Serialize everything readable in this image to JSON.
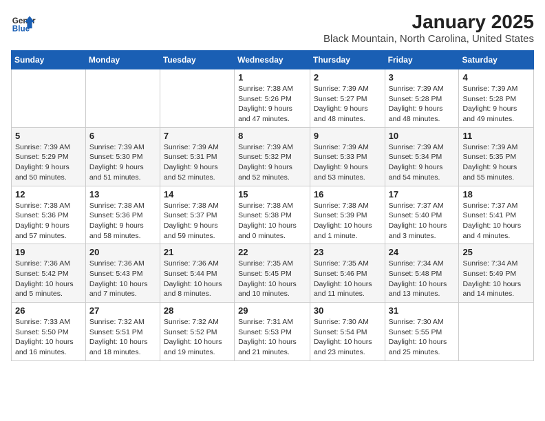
{
  "header": {
    "logo_line1": "General",
    "logo_line2": "Blue",
    "title": "January 2025",
    "subtitle": "Black Mountain, North Carolina, United States"
  },
  "weekdays": [
    "Sunday",
    "Monday",
    "Tuesday",
    "Wednesday",
    "Thursday",
    "Friday",
    "Saturday"
  ],
  "weeks": [
    [
      {
        "day": "",
        "info": ""
      },
      {
        "day": "",
        "info": ""
      },
      {
        "day": "",
        "info": ""
      },
      {
        "day": "1",
        "info": "Sunrise: 7:38 AM\nSunset: 5:26 PM\nDaylight: 9 hours and 47 minutes."
      },
      {
        "day": "2",
        "info": "Sunrise: 7:39 AM\nSunset: 5:27 PM\nDaylight: 9 hours and 48 minutes."
      },
      {
        "day": "3",
        "info": "Sunrise: 7:39 AM\nSunset: 5:28 PM\nDaylight: 9 hours and 48 minutes."
      },
      {
        "day": "4",
        "info": "Sunrise: 7:39 AM\nSunset: 5:28 PM\nDaylight: 9 hours and 49 minutes."
      }
    ],
    [
      {
        "day": "5",
        "info": "Sunrise: 7:39 AM\nSunset: 5:29 PM\nDaylight: 9 hours and 50 minutes."
      },
      {
        "day": "6",
        "info": "Sunrise: 7:39 AM\nSunset: 5:30 PM\nDaylight: 9 hours and 51 minutes."
      },
      {
        "day": "7",
        "info": "Sunrise: 7:39 AM\nSunset: 5:31 PM\nDaylight: 9 hours and 52 minutes."
      },
      {
        "day": "8",
        "info": "Sunrise: 7:39 AM\nSunset: 5:32 PM\nDaylight: 9 hours and 52 minutes."
      },
      {
        "day": "9",
        "info": "Sunrise: 7:39 AM\nSunset: 5:33 PM\nDaylight: 9 hours and 53 minutes."
      },
      {
        "day": "10",
        "info": "Sunrise: 7:39 AM\nSunset: 5:34 PM\nDaylight: 9 hours and 54 minutes."
      },
      {
        "day": "11",
        "info": "Sunrise: 7:39 AM\nSunset: 5:35 PM\nDaylight: 9 hours and 55 minutes."
      }
    ],
    [
      {
        "day": "12",
        "info": "Sunrise: 7:38 AM\nSunset: 5:36 PM\nDaylight: 9 hours and 57 minutes."
      },
      {
        "day": "13",
        "info": "Sunrise: 7:38 AM\nSunset: 5:36 PM\nDaylight: 9 hours and 58 minutes."
      },
      {
        "day": "14",
        "info": "Sunrise: 7:38 AM\nSunset: 5:37 PM\nDaylight: 9 hours and 59 minutes."
      },
      {
        "day": "15",
        "info": "Sunrise: 7:38 AM\nSunset: 5:38 PM\nDaylight: 10 hours and 0 minutes."
      },
      {
        "day": "16",
        "info": "Sunrise: 7:38 AM\nSunset: 5:39 PM\nDaylight: 10 hours and 1 minute."
      },
      {
        "day": "17",
        "info": "Sunrise: 7:37 AM\nSunset: 5:40 PM\nDaylight: 10 hours and 3 minutes."
      },
      {
        "day": "18",
        "info": "Sunrise: 7:37 AM\nSunset: 5:41 PM\nDaylight: 10 hours and 4 minutes."
      }
    ],
    [
      {
        "day": "19",
        "info": "Sunrise: 7:36 AM\nSunset: 5:42 PM\nDaylight: 10 hours and 5 minutes."
      },
      {
        "day": "20",
        "info": "Sunrise: 7:36 AM\nSunset: 5:43 PM\nDaylight: 10 hours and 7 minutes."
      },
      {
        "day": "21",
        "info": "Sunrise: 7:36 AM\nSunset: 5:44 PM\nDaylight: 10 hours and 8 minutes."
      },
      {
        "day": "22",
        "info": "Sunrise: 7:35 AM\nSunset: 5:45 PM\nDaylight: 10 hours and 10 minutes."
      },
      {
        "day": "23",
        "info": "Sunrise: 7:35 AM\nSunset: 5:46 PM\nDaylight: 10 hours and 11 minutes."
      },
      {
        "day": "24",
        "info": "Sunrise: 7:34 AM\nSunset: 5:48 PM\nDaylight: 10 hours and 13 minutes."
      },
      {
        "day": "25",
        "info": "Sunrise: 7:34 AM\nSunset: 5:49 PM\nDaylight: 10 hours and 14 minutes."
      }
    ],
    [
      {
        "day": "26",
        "info": "Sunrise: 7:33 AM\nSunset: 5:50 PM\nDaylight: 10 hours and 16 minutes."
      },
      {
        "day": "27",
        "info": "Sunrise: 7:32 AM\nSunset: 5:51 PM\nDaylight: 10 hours and 18 minutes."
      },
      {
        "day": "28",
        "info": "Sunrise: 7:32 AM\nSunset: 5:52 PM\nDaylight: 10 hours and 19 minutes."
      },
      {
        "day": "29",
        "info": "Sunrise: 7:31 AM\nSunset: 5:53 PM\nDaylight: 10 hours and 21 minutes."
      },
      {
        "day": "30",
        "info": "Sunrise: 7:30 AM\nSunset: 5:54 PM\nDaylight: 10 hours and 23 minutes."
      },
      {
        "day": "31",
        "info": "Sunrise: 7:30 AM\nSunset: 5:55 PM\nDaylight: 10 hours and 25 minutes."
      },
      {
        "day": "",
        "info": ""
      }
    ]
  ]
}
